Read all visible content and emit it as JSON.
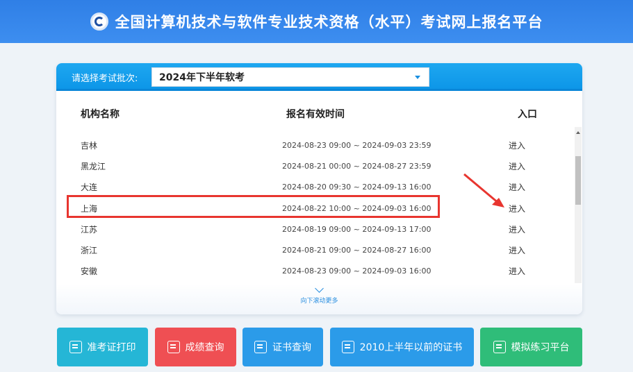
{
  "header": {
    "title": "全国计算机技术与软件专业技术资格（水平）考试网上报名平台"
  },
  "batch": {
    "label": "请选择考试批次:",
    "selected": "2024年下半年软考"
  },
  "table": {
    "headers": {
      "name": "机构名称",
      "time": "报名有效时间",
      "entry": "入口"
    },
    "rows": [
      {
        "name": "吉林",
        "time": "2024-08-23 09:00 ~ 2024-09-03 23:59",
        "entry": "进入"
      },
      {
        "name": "黑龙江",
        "time": "2024-08-21 00:00 ~ 2024-08-27 23:59",
        "entry": "进入"
      },
      {
        "name": "大连",
        "time": "2024-08-20 09:30 ~ 2024-09-13 16:00",
        "entry": "进入"
      },
      {
        "name": "上海",
        "time": "2024-08-22 10:00 ~ 2024-09-03 16:00",
        "entry": "进入"
      },
      {
        "name": "江苏",
        "time": "2024-08-19 09:00 ~ 2024-09-13 17:00",
        "entry": "进入"
      },
      {
        "name": "浙江",
        "time": "2024-08-21 09:00 ~ 2024-08-27 16:00",
        "entry": "进入"
      },
      {
        "name": "安徽",
        "time": "2024-08-23 09:00 ~ 2024-09-03 16:00",
        "entry": "进入"
      }
    ],
    "more": "向下滚动更多"
  },
  "buttons": {
    "admit": "准考证打印",
    "score": "成绩查询",
    "cert": "证书查询",
    "cert_old": "2010上半年以前的证书",
    "practice": "模拟练习平台"
  },
  "colors": {
    "header": "#3d8ef0",
    "admit": "#25b6d6",
    "score": "#ef4f53",
    "cert": "#2b9be9",
    "practice": "#2fbd79",
    "highlight": "#e8352f"
  }
}
